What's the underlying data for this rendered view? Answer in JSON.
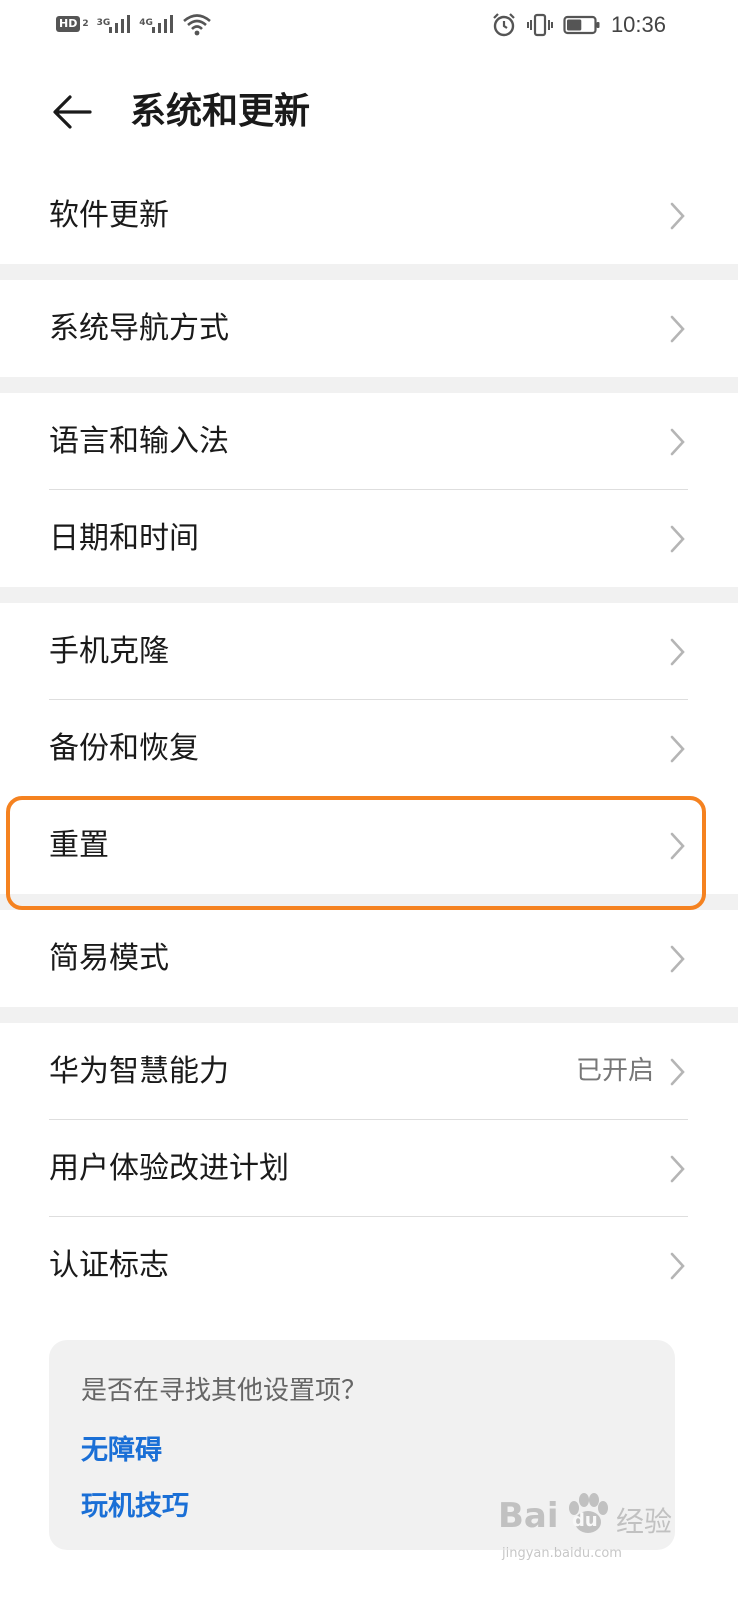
{
  "status_bar": {
    "hd_label": "HD",
    "hd_sub": "2",
    "net1": "3G",
    "net2": "4G",
    "time": "10:36",
    "battery_level": 0.55
  },
  "header": {
    "title": "系统和更新"
  },
  "groups": [
    [
      {
        "label": "软件更新"
      }
    ],
    [
      {
        "label": "系统导航方式"
      }
    ],
    [
      {
        "label": "语言和输入法"
      },
      {
        "label": "日期和时间"
      }
    ],
    [
      {
        "label": "手机克隆"
      },
      {
        "label": "备份和恢复"
      },
      {
        "label": "重置"
      }
    ],
    [
      {
        "label": "简易模式"
      }
    ],
    [
      {
        "label": "华为智慧能力",
        "value": "已开启"
      },
      {
        "label": "用户体验改进计划"
      },
      {
        "label": "认证标志"
      }
    ]
  ],
  "suggestions": {
    "title": "是否在寻找其他设置项？",
    "links": [
      "无障碍",
      "玩机技巧"
    ]
  },
  "watermark": {
    "brand": "Bai",
    "brand2": "du",
    "jingyan": "经验",
    "url": "jingyan.baidu.com"
  },
  "colors": {
    "highlight": "#f58220",
    "link": "#1a6fd6"
  }
}
